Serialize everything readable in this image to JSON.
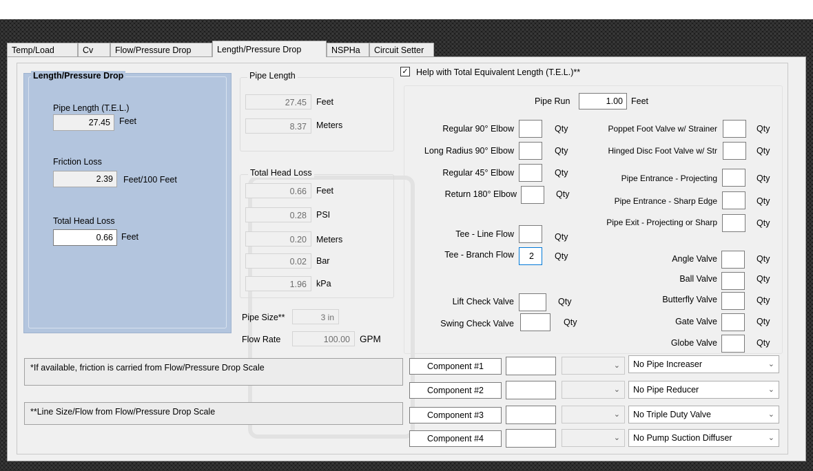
{
  "tabs": [
    "Temp/Load",
    "Cv",
    "Flow/Pressure Drop",
    "Length/Pressure Drop",
    "NSPHa",
    "Circuit Setter"
  ],
  "active_tab": "Length/Pressure Drop",
  "left_panel": {
    "title": "Length/Pressure Drop",
    "pipe_length_label": "Pipe Length (T.E.L.)",
    "pipe_length_value": "27.45",
    "pipe_length_unit": "Feet",
    "friction_loss_label": "Friction Loss",
    "friction_loss_value": "2.39",
    "friction_loss_unit": "Feet/100 Feet",
    "total_head_loss_label": "Total Head Loss",
    "total_head_loss_value": "0.66",
    "total_head_loss_unit": "Feet"
  },
  "pipe_length_group": {
    "title": "Pipe Length",
    "rows": [
      {
        "value": "27.45",
        "unit": "Feet"
      },
      {
        "value": "8.37",
        "unit": "Meters"
      }
    ]
  },
  "total_head_loss_group": {
    "title": "Total Head Loss",
    "rows": [
      {
        "value": "0.66",
        "unit": "Feet"
      },
      {
        "value": "0.28",
        "unit": "PSI"
      },
      {
        "value": "0.20",
        "unit": "Meters"
      },
      {
        "value": "0.02",
        "unit": "Bar"
      },
      {
        "value": "1.96",
        "unit": "kPa"
      }
    ]
  },
  "pipe_size": {
    "label": "Pipe Size**",
    "value": "3 in"
  },
  "flow_rate": {
    "label": "Flow Rate",
    "value": "100.00",
    "unit": "GPM"
  },
  "notes": {
    "note1": "*If available, friction is carried from Flow/Pressure Drop Scale",
    "note2": "**Line Size/Flow from Flow/Pressure Drop Scale"
  },
  "tel_help": {
    "checked": true,
    "label": "Help with Total Equivalent Length (T.E.L.)**",
    "pipe_run_label": "Pipe Run",
    "pipe_run_value": "1.00",
    "pipe_run_unit": "Feet",
    "qty_label": "Qty",
    "left_fittings": [
      {
        "label": "Regular 90° Elbow",
        "value": ""
      },
      {
        "label": "Long Radius 90° Elbow",
        "value": ""
      },
      {
        "label": "Regular 45° Elbow",
        "value": ""
      },
      {
        "label": "Return 180° Elbow",
        "value": ""
      },
      {
        "label": "Tee - Line Flow",
        "value": ""
      },
      {
        "label": "Tee - Branch Flow",
        "value": "2"
      },
      {
        "label": "Lift Check Valve",
        "value": ""
      },
      {
        "label": "Swing Check Valve",
        "value": ""
      }
    ],
    "right_fittings": [
      {
        "label": "Poppet Foot Valve w/ Strainer",
        "value": ""
      },
      {
        "label": "Hinged Disc Foot Valve w/ Str",
        "value": ""
      },
      {
        "label": "Pipe Entrance - Projecting",
        "value": ""
      },
      {
        "label": "Pipe Entrance -  Sharp Edge",
        "value": ""
      },
      {
        "label": "Pipe Exit -  Projecting or Sharp",
        "value": ""
      },
      {
        "label": "Angle Valve",
        "value": ""
      },
      {
        "label": "Ball Valve",
        "value": ""
      },
      {
        "label": "Butterfly Valve",
        "value": ""
      },
      {
        "label": "Gate Valve",
        "value": ""
      },
      {
        "label": "Globe Valve",
        "value": ""
      }
    ],
    "components": [
      {
        "label": "Component #1",
        "value": "",
        "select": "",
        "option": "No Pipe Increaser"
      },
      {
        "label": "Component #2",
        "value": "",
        "select": "",
        "option": "No Pipe Reducer"
      },
      {
        "label": "Component #3",
        "value": "",
        "select": "",
        "option": "No Triple Duty Valve"
      },
      {
        "label": "Component #4",
        "value": "",
        "select": "",
        "option": "No Pump Suction Diffuser"
      }
    ]
  }
}
